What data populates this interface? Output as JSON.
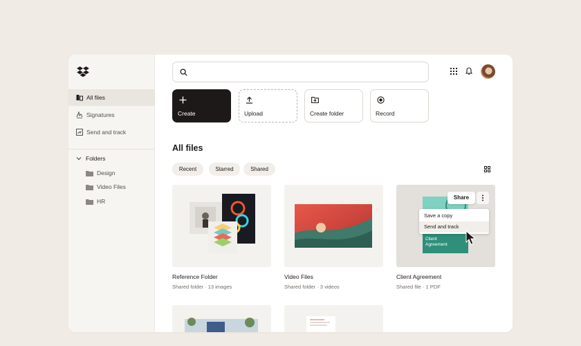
{
  "sidebar": {
    "nav": [
      {
        "label": "All files",
        "icon": "files-icon",
        "active": true
      },
      {
        "label": "Signatures",
        "icon": "signature-icon"
      },
      {
        "label": "Send and track",
        "icon": "send-track-icon"
      }
    ],
    "folders_label": "Folders",
    "folders": [
      "Design",
      "Video Files",
      "HR"
    ]
  },
  "search": {
    "placeholder": ""
  },
  "actions": [
    {
      "label": "Create",
      "icon": "plus-icon"
    },
    {
      "label": "Upload",
      "icon": "upload-icon"
    },
    {
      "label": "Create folder",
      "icon": "folder-add-icon"
    },
    {
      "label": "Record",
      "icon": "record-icon"
    }
  ],
  "main": {
    "title": "All files",
    "filters": [
      "Recent",
      "Starred",
      "Shared"
    ]
  },
  "files": [
    {
      "name": "Reference Folder",
      "meta": "Shared folder · 13 images"
    },
    {
      "name": "Video Files",
      "meta": "Shared folder · 3 videos"
    },
    {
      "name": "Client Agreement",
      "meta": "Shared file · 1 PDF"
    }
  ],
  "context_menu": {
    "share_label": "Share",
    "options": [
      "Save a copy",
      "Send and track"
    ],
    "doc_title": "Client Agreement"
  },
  "colors": {
    "background": "#f1ebe5",
    "primary": "#1e1919",
    "accent_teal": "#2f8f7a"
  }
}
